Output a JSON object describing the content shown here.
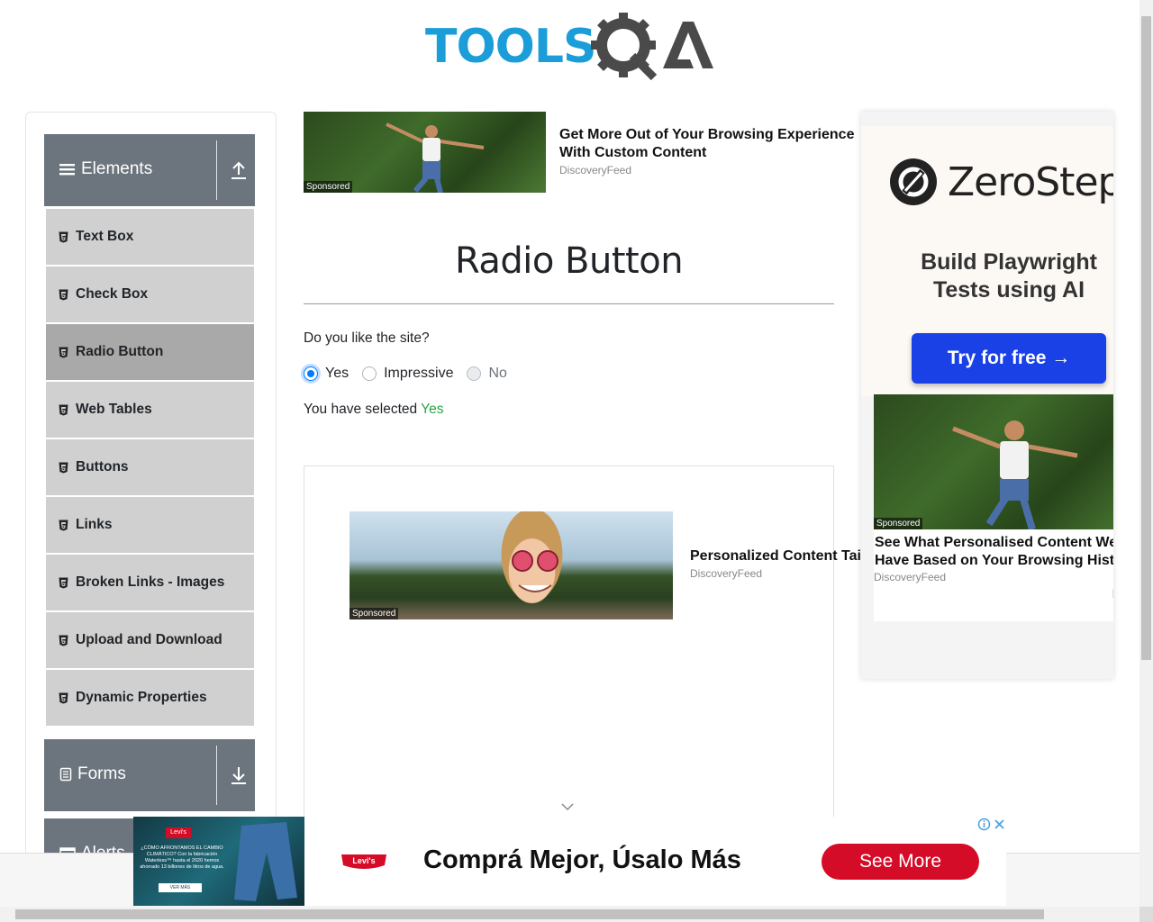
{
  "brand": {
    "logo_text": "TOOLS",
    "logo_suffix": "QA",
    "logo_color": "#1a9dd9"
  },
  "sidebar": {
    "group_elements": "Elements",
    "items": [
      {
        "label": "Text Box",
        "active": false
      },
      {
        "label": "Check Box",
        "active": false
      },
      {
        "label": "Radio Button",
        "active": true
      },
      {
        "label": "Web Tables",
        "active": false
      },
      {
        "label": "Buttons",
        "active": false
      },
      {
        "label": "Links",
        "active": false
      },
      {
        "label": "Broken Links - Images",
        "active": false
      },
      {
        "label": "Upload and Download",
        "active": false
      },
      {
        "label": "Dynamic Properties",
        "active": false
      }
    ],
    "group_forms": "Forms",
    "group_alerts": "Alerts, Frame & Windows"
  },
  "ad_top": {
    "title": "Get More Out of Your Browsing Experience With Custom Content",
    "source": "DiscoveryFeed",
    "sponsored": "Sponsored"
  },
  "main": {
    "title": "Radio Button",
    "question": "Do you like the site?",
    "options": [
      {
        "label": "Yes",
        "state": "checked"
      },
      {
        "label": "Impressive",
        "state": "unchecked"
      },
      {
        "label": "No",
        "state": "disabled"
      }
    ],
    "result_prefix": "You have selected",
    "result_value": "Yes"
  },
  "ad_mid": {
    "title": "Personalized Content Tailored",
    "source": "DiscoveryFeed",
    "sponsored": "Sponsored"
  },
  "right_ad": {
    "brand": "ZeroStep",
    "tagline": "Build Playwright Tests using AI",
    "cta": "Try for free →",
    "feed_title": "See What Personalised Content We Have Based on Your Browsing History",
    "feed_source": "DiscoveryFeed",
    "feed_help": "[?]",
    "sponsored": "Sponsored"
  },
  "banner": {
    "img_brand": "Levi's",
    "img_text": "¿CÓMO AFRONTAMOS EL CAMBIO CLIMÁTICO? Con la fabricación Waterless™ hasta el 2020 hemos ahorrado 13 billones de litros de agua.",
    "img_cta": "VER MÁS",
    "brand": "Levi's",
    "headline": "Comprá Mejor, Úsalo Más",
    "cta": "See More"
  },
  "colors": {
    "accent": "#007bff",
    "success": "#28a745",
    "sidebar_header": "#6c757d",
    "menu_item": "#d0d0d0",
    "menu_active": "#a9a9a9",
    "zerostep_button": "#1a41e6",
    "levis_red": "#d50c28"
  }
}
